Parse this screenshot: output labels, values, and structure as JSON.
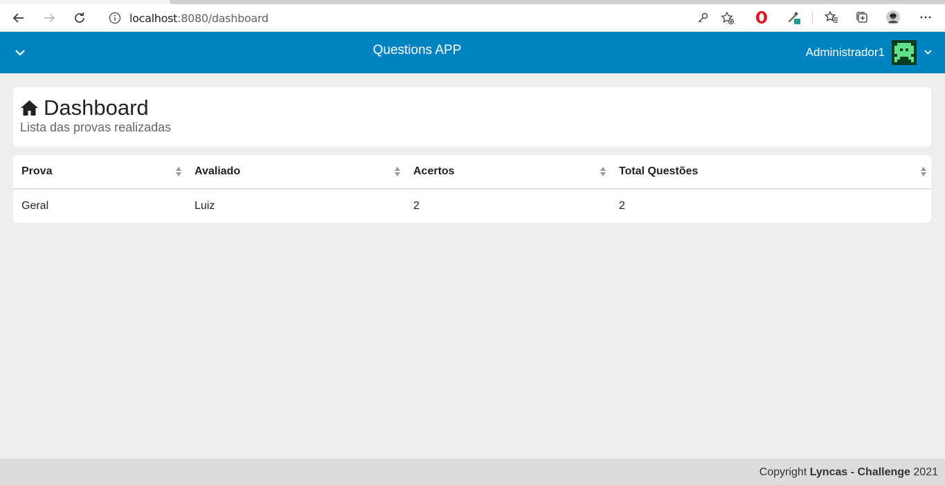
{
  "browser": {
    "url_host": "localhost",
    "url_rest": ":8080/dashboard"
  },
  "header": {
    "title": "Questions APP",
    "user": "Administrador1",
    "color": "#0083c1"
  },
  "dashboard": {
    "title": "Dashboard",
    "subtitle": "Lista das provas realizadas"
  },
  "table": {
    "columns": [
      "Prova",
      "Avaliado",
      "Acertos",
      "Total Questões"
    ],
    "rows": [
      [
        "Geral",
        "Luiz",
        "2",
        "2"
      ]
    ]
  },
  "footer": {
    "prefix": "Copyright ",
    "brand": "Lyncas - Challenge",
    "year": " 2021"
  }
}
